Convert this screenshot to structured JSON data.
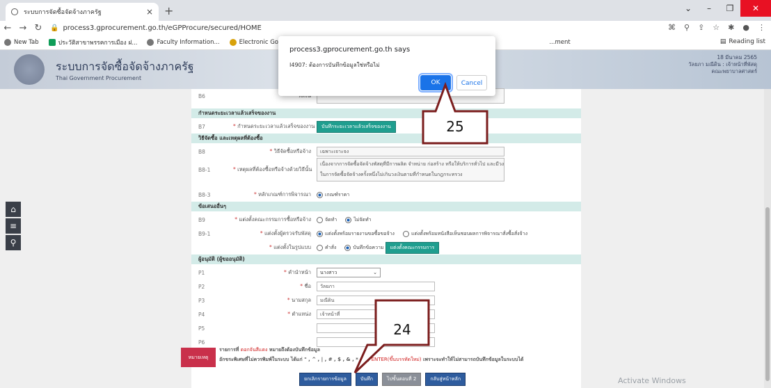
{
  "browser": {
    "tab_title": "ระบบการจัดซื้อจัดจ้างภาครัฐ",
    "url": "process3.gprocurement.go.th/eGPProcure/secured/HOME",
    "new_tab_symbol": "+"
  },
  "bookmarks": [
    "New Tab",
    "ประวัติสาขาพรรคการเมือง ฝ...",
    "Faculty Information...",
    "Electronic Governm...",
    "...ment"
  ],
  "reading_list": "Reading list",
  "header": {
    "system_name_th": "ระบบการจัดซื้อจัดจ้างภาครัฐ",
    "system_name_en": "Thai Government Procurement",
    "user_lines": [
      "18 มีนาคม 2565",
      "วัลยภา มณีดิน : เจ้าหน้าที่พัสดุ",
      "คณะพยาบาลศาสตร์"
    ]
  },
  "dialog": {
    "title": "process3.gprocurement.go.th says",
    "message": "I4907: ต้องการบันทึกข้อมูลใช่หรือไม่",
    "ok": "OK",
    "cancel": "Cancel"
  },
  "form": {
    "b6": {
      "code": "B6",
      "label": "วงเงิน",
      "value": "รวม"
    },
    "sec_duration": "กำหนดระยะเวลาแล้วเสร็จของงาน",
    "b7": {
      "code": "B7",
      "label": "กำหนดระยะเวลาแล้วเสร็จของงาน",
      "button": "บันทึกระยะเวลาแล้วเสร็จของงาน"
    },
    "sec_method": "วิธีจัดซื้อ และเหตุผลที่ต้องซื้อ",
    "b8": {
      "code": "B8",
      "label": "วิธีจัดซื้อหรือจ้าง",
      "value": "เฉพาะเจาะจง"
    },
    "b81": {
      "code": "B8-1",
      "label": "เหตุผลที่ต้องซื้อหรือจ้างด้วยวิธีนั้น",
      "value1": "เนื่องจากการจัดซื้อจัดจ้างพัสดุที่มีการผลิต จำหน่าย ก่อสร้าง หรือให้บริการทั่วไป และมีวงเงิน",
      "value2": "ในการจัดซื้อจัดจ้างครั้งหนึ่งไม่เกินวงเงินตามที่กำหนดในกฎกระทรวง"
    },
    "b83": {
      "code": "B8-3",
      "label": "หลักเกณฑ์การพิจารณา",
      "option": "เกณฑ์ราคา"
    },
    "sec_other": "ข้อเสนออื่นๆ",
    "b9": {
      "code": "B9",
      "label": "แต่งตั้งคณะกรรมการซื้อหรือจ้าง",
      "opt1": "จัดทำ",
      "opt2": "ไม่จัดทำ"
    },
    "b91": {
      "code": "B9-1",
      "label": "แต่งตั้งผู้ตรวจรับพัสดุ",
      "opt1": "แต่งตั้งพร้อมรายงานขอซื้อขอจ้าง",
      "opt2": "แต่งตั้งพร้อมหนังสือเห็นชอบผลการพิจารณาสั่งซื้อสั่งจ้าง"
    },
    "b92": {
      "label": "แต่งตั้งในรูปแบบ",
      "opt1": "คำสั่ง",
      "opt2": "บันทึกข้อความ",
      "button": "แต่งตั้งคณะกรรมการ"
    },
    "sec_approver": "ผู้อนุมัติ (ผู้ขออนุมัติ)",
    "p1": {
      "code": "P1",
      "label": "คำนำหน้า",
      "value": "นางสาว"
    },
    "p2": {
      "code": "P2",
      "label": "ชื่อ",
      "value": "วัลยภา"
    },
    "p3": {
      "code": "P3",
      "label": "นามสกุล",
      "value": "มณีดิน"
    },
    "p4": {
      "code": "P4",
      "label": "ตำแหน่ง",
      "value": "เจ้าหน้าที่"
    },
    "p5": {
      "code": "P5"
    },
    "p6": {
      "code": "P6"
    }
  },
  "remark": {
    "badge": "หมายเหตุ",
    "line1a": "รายการที่ ",
    "line1b": "ดอกจันสีแดง",
    "line1c": " หมายถึงต้องบันทึกข้อมูล",
    "line2a": "อักขระพิเศษที่ไม่ควรพิมพ์ในระบบ ได้แก่ \" , ^ , | , # , $ , & , * , \" , ",
    "line2b": "ENTER(ขึ้นบรรทัดใหม่)",
    "line2c": " เพราะจะทำให้ไม่สามารถบันทึกข้อมูลในระบบได้"
  },
  "footer": {
    "b1": "ยกเลิกรายการข้อมูล",
    "b2": "บันทึก",
    "b3": "ไปขั้นตอนที่ 2",
    "b4": "กลับสู่หน้าหลัก"
  },
  "callouts": {
    "c24": "24",
    "c25": "25"
  },
  "watermark": "Activate Windows"
}
